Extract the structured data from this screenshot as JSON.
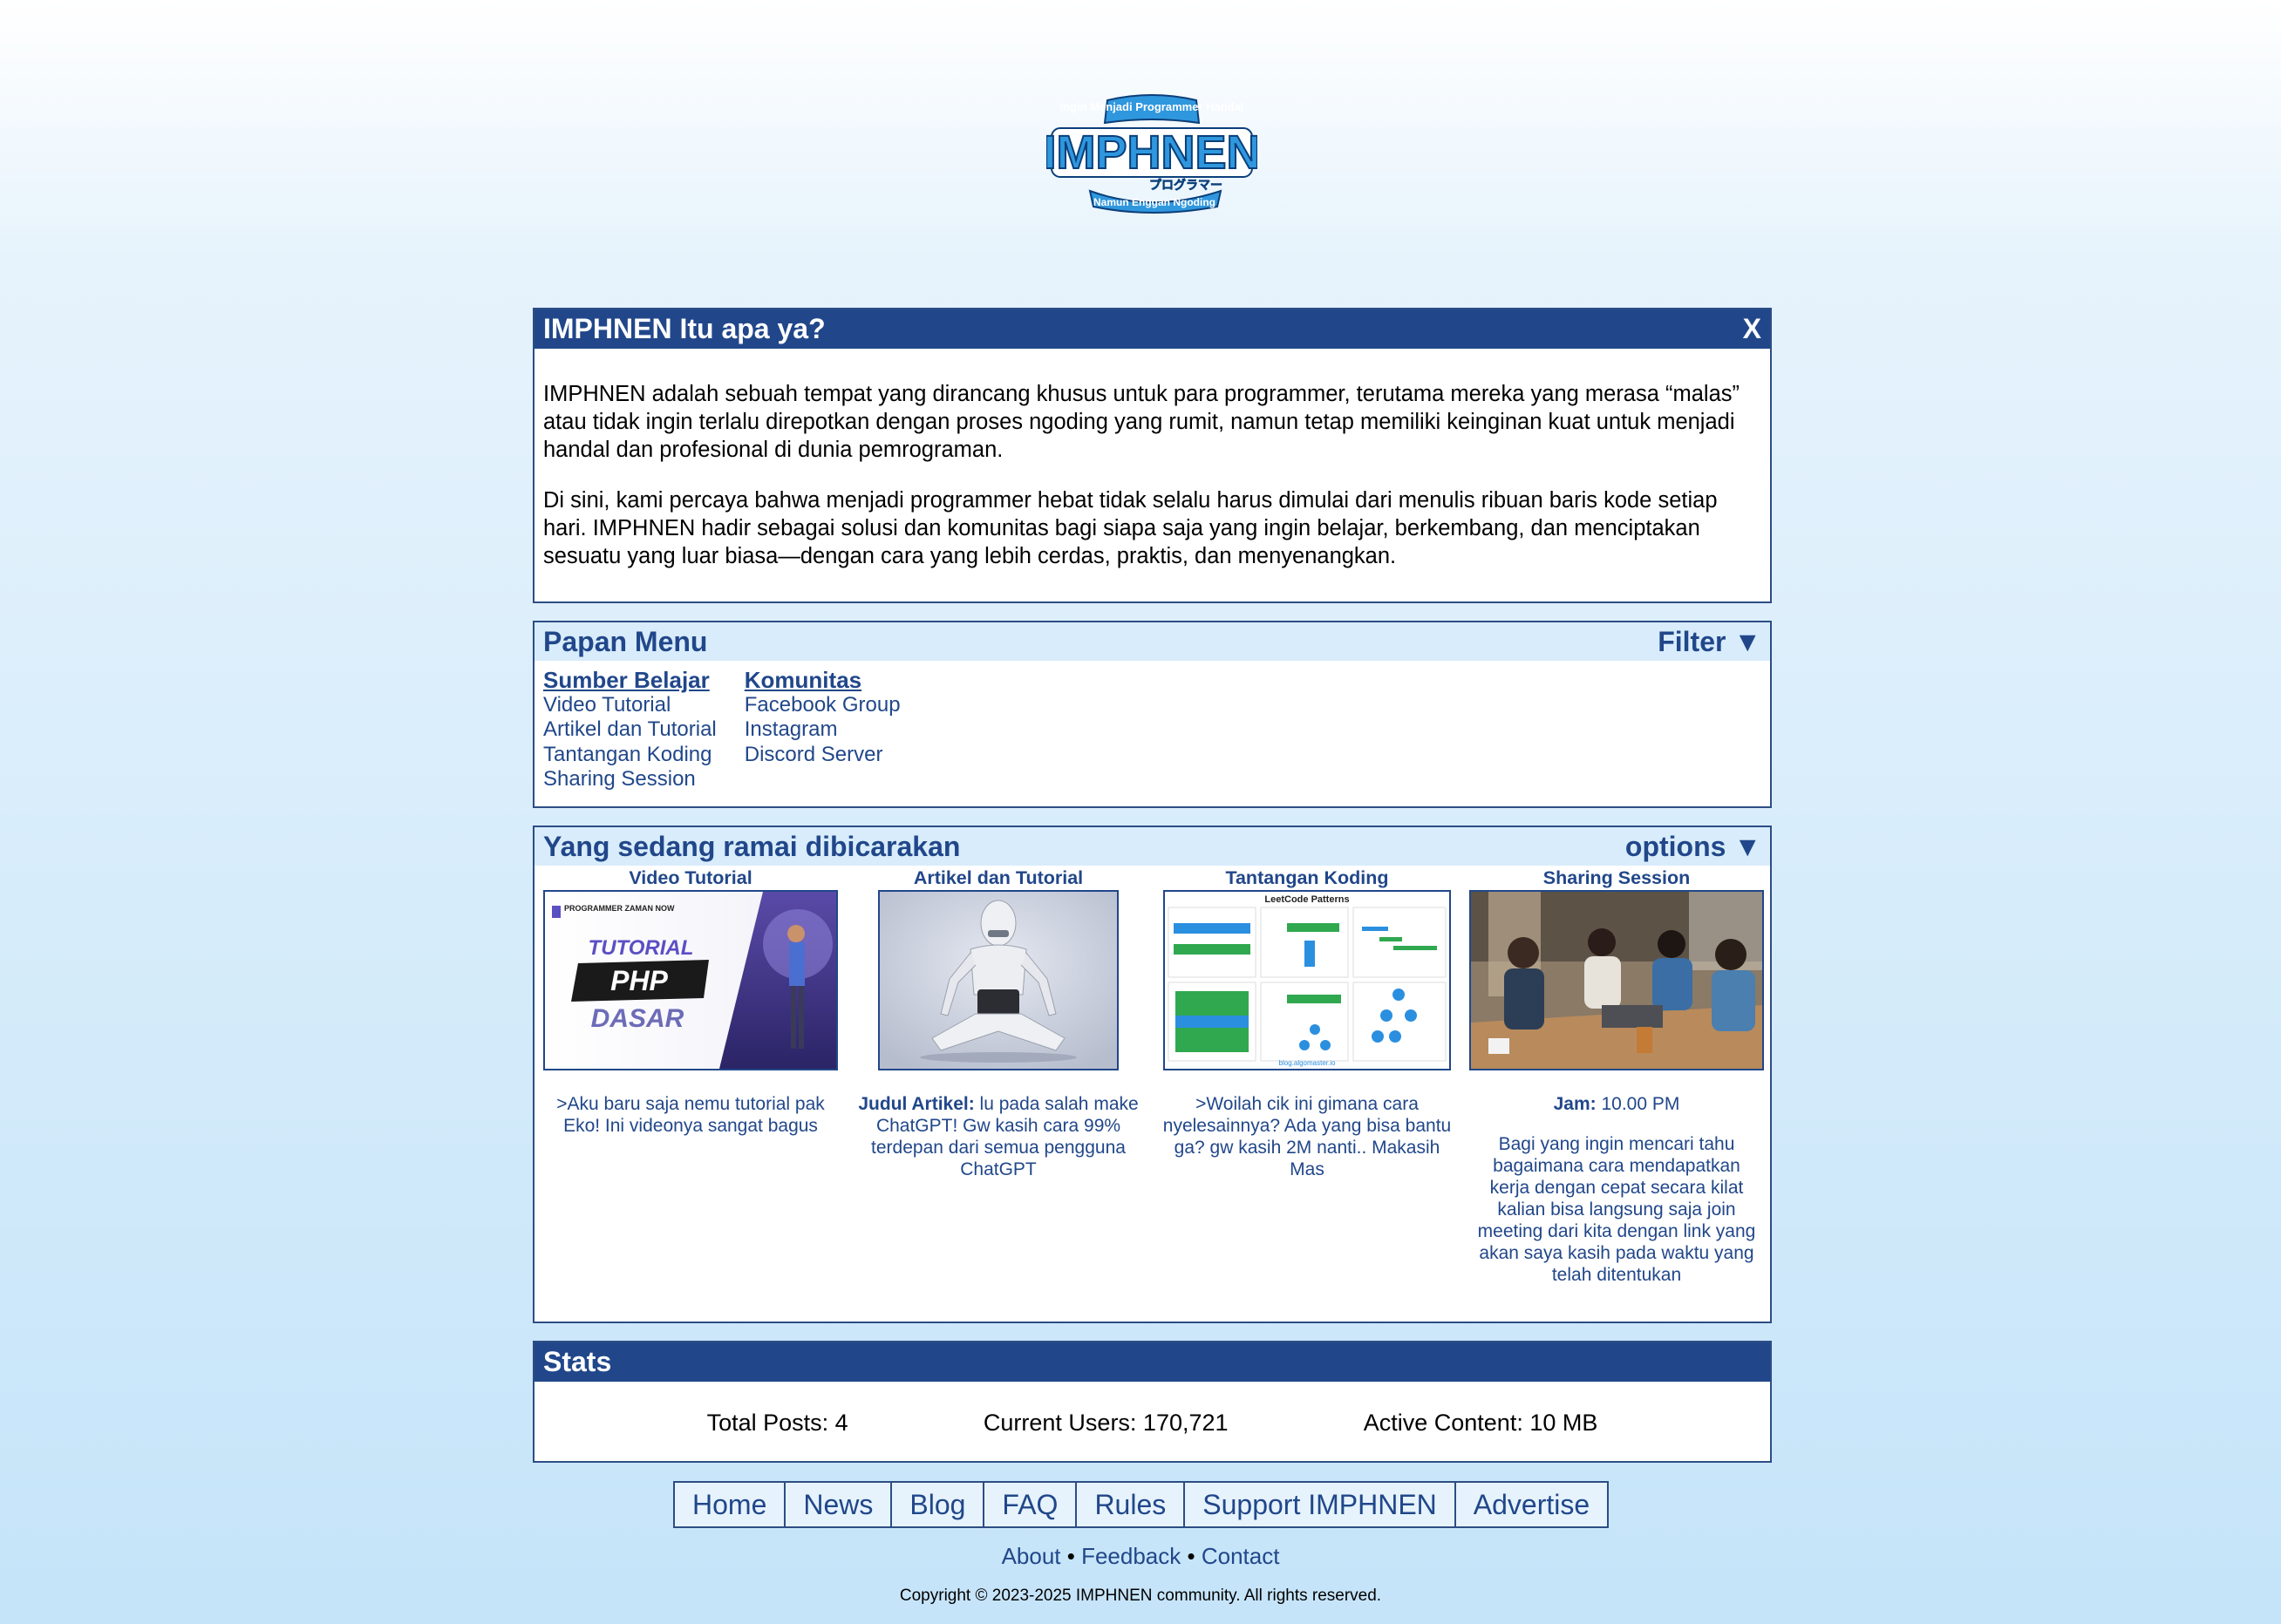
{
  "logo": {
    "top_text": "Ingin Menjadi Programmer Handal",
    "main_text": "IMPHNEN",
    "jp_text": "プログラマー",
    "bottom_text": "Namun Enggan Ngoding"
  },
  "about": {
    "title": "IMPHNEN Itu apa ya?",
    "close_label": "X",
    "p1": "IMPHNEN adalah sebuah tempat yang dirancang khusus untuk para programmer, terutama mereka yang merasa “malas” atau tidak ingin terlalu direpotkan dengan proses ngoding yang rumit, namun tetap memiliki keinginan kuat untuk menjadi handal dan profesional di dunia pemrograman.",
    "p2": "Di sini, kami percaya bahwa menjadi programmer hebat tidak selalu harus dimulai dari menulis ribuan baris kode setiap hari. IMPHNEN hadir sebagai solusi dan komunitas bagi siapa saja yang ingin belajar, berkembang, dan menciptakan sesuatu yang luar biasa—dengan cara yang lebih cerdas, praktis, dan menyenangkan."
  },
  "menu": {
    "title": "Papan Menu",
    "filter_label": "Filter ▼",
    "sumber": {
      "heading": "Sumber Belajar",
      "items": [
        "Video Tutorial",
        "Artikel dan Tutorial",
        "Tantangan Koding",
        "Sharing Session"
      ]
    },
    "komunitas": {
      "heading": "Komunitas",
      "items": [
        "Facebook Group",
        "Instagram",
        "Discord Server"
      ]
    }
  },
  "trending": {
    "title": "Yang sedang ramai dibicarakan",
    "options_label": "options ▼",
    "video": {
      "title": "Video Tutorial",
      "thumb_brand": "PROGRAMMER ZAMAN NOW",
      "thumb_l1": "TUTORIAL",
      "thumb_l2": "PHP",
      "thumb_l3": "DASAR",
      "desc": ">Aku baru saja nemu tutorial pak Eko! Ini videonya sangat bagus"
    },
    "artikel": {
      "title": "Artikel dan Tutorial",
      "label": "Judul Artikel:",
      "desc": " lu pada salah make ChatGPT! Gw kasih cara 99% terdepan dari semua pengguna ChatGPT"
    },
    "koding": {
      "title": "Tantangan Koding",
      "thumb_title": "LeetCode Patterns",
      "thumb_footer": "blog.algomaster.io",
      "desc": ">Woilah cik ini gimana cara nyelesainnya? Ada yang bisa bantu ga? gw kasih 2M nanti.. Makasih Mas"
    },
    "sharing": {
      "title": "Sharing Session",
      "jam_label": "Jam:",
      "jam_value": " 10.00 PM",
      "desc": "Bagi yang ingin mencari tahu bagaimana cara mendapatkan kerja dengan cepat secara kilat kalian bisa langsung saja join meeting dari kita dengan link yang akan saya kasih pada waktu yang telah ditentukan"
    }
  },
  "stats": {
    "title": "Stats",
    "total_posts": "Total Posts: 4",
    "current_users": "Current Users: 170,721",
    "active_content": "Active Content: 10 MB"
  },
  "nav": [
    "Home",
    "News",
    "Blog",
    "FAQ",
    "Rules",
    "Support IMPHNEN",
    "Advertise"
  ],
  "footer": {
    "about": "About",
    "feedback": "Feedback",
    "contact": "Contact",
    "sep": " • ",
    "copyright": "Copyright © 2023-2025 IMPHNEN community. All rights reserved."
  },
  "colors": {
    "primary": "#21478a",
    "light_bar": "#d8ecfb",
    "logo_blue": "#2f97de"
  }
}
